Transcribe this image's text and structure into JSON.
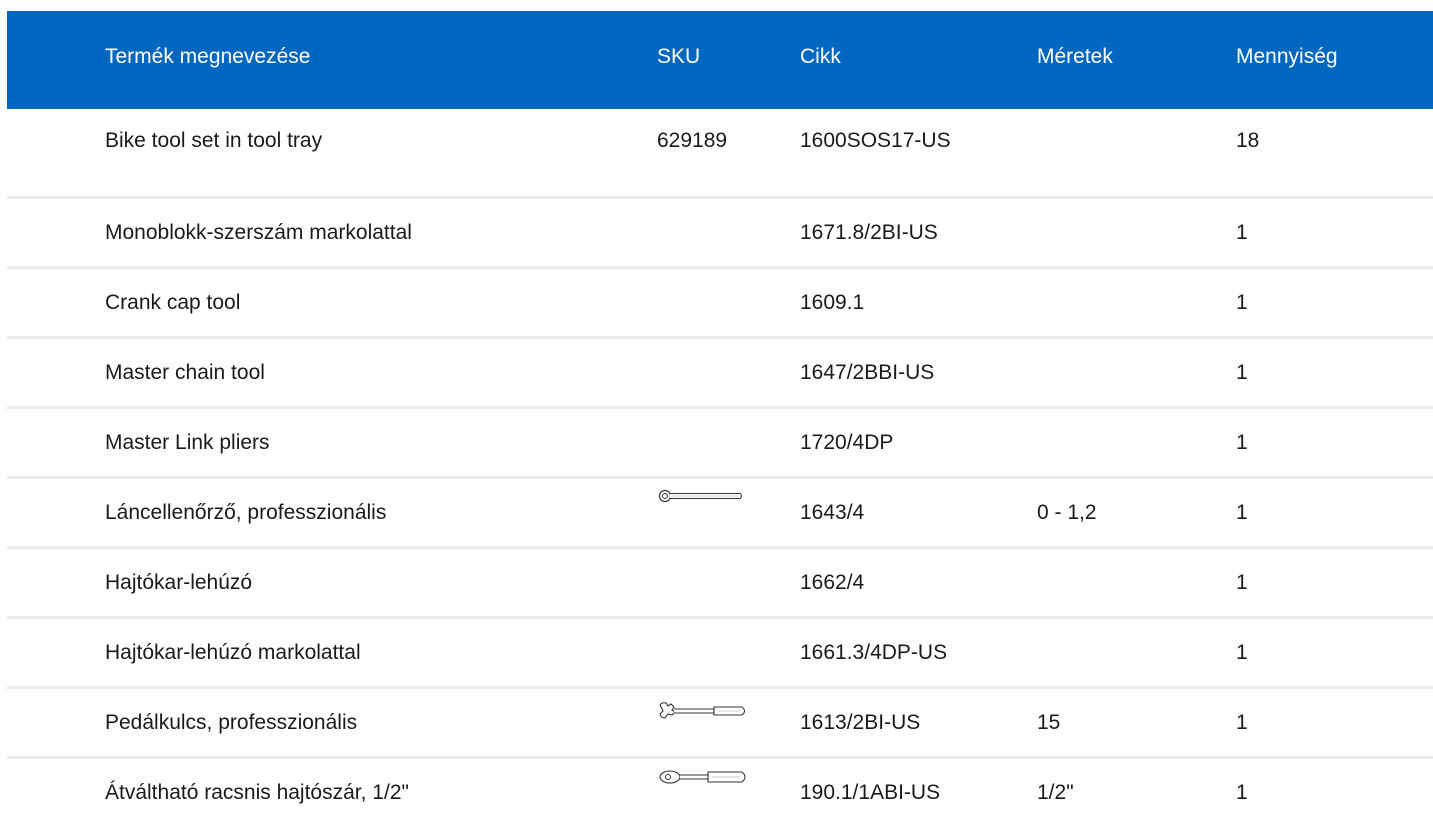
{
  "table": {
    "headers": {
      "name": "Termék megnevezése",
      "sku": "SKU",
      "cikk": "Cikk",
      "meretek": "Méretek",
      "mennyiseg": "Mennyiség"
    },
    "rows": [
      {
        "name": "Bike tool set in tool tray",
        "sku": "629189",
        "cikk": "1600SOS17-US",
        "meretek": "",
        "mennyiseg": "18",
        "icon": ""
      },
      {
        "name": "Monoblokk-szerszám markolattal",
        "sku": "",
        "cikk": "1671.8/2BI-US",
        "meretek": "",
        "mennyiseg": "1",
        "icon": ""
      },
      {
        "name": "Crank cap tool",
        "sku": "",
        "cikk": "1609.1",
        "meretek": "",
        "mennyiseg": "1",
        "icon": ""
      },
      {
        "name": "Master chain tool",
        "sku": "",
        "cikk": "1647/2BBI-US",
        "meretek": "",
        "mennyiseg": "1",
        "icon": ""
      },
      {
        "name": "Master Link pliers",
        "sku": "",
        "cikk": "1720/4DP",
        "meretek": "",
        "mennyiseg": "1",
        "icon": ""
      },
      {
        "name": "Láncellenőrző, professzionális",
        "sku": "",
        "cikk": "1643/4",
        "meretek": "0 - 1,2",
        "mennyiseg": "1",
        "icon": "chain-checker-icon"
      },
      {
        "name": "Hajtókar-lehúzó",
        "sku": "",
        "cikk": "1662/4",
        "meretek": "",
        "mennyiseg": "1",
        "icon": ""
      },
      {
        "name": "Hajtókar-lehúzó markolattal",
        "sku": "",
        "cikk": "1661.3/4DP-US",
        "meretek": "",
        "mennyiseg": "1",
        "icon": ""
      },
      {
        "name": "Pedálkulcs, professzionális",
        "sku": "",
        "cikk": "1613/2BI-US",
        "meretek": "15",
        "mennyiseg": "1",
        "icon": "pedal-wrench-icon"
      },
      {
        "name": "Átváltható racsnis hajtószár, 1/2\"",
        "sku": "",
        "cikk": "190.1/1ABI-US",
        "meretek": "1/2\"",
        "mennyiseg": "1",
        "icon": "ratchet-icon"
      }
    ]
  }
}
